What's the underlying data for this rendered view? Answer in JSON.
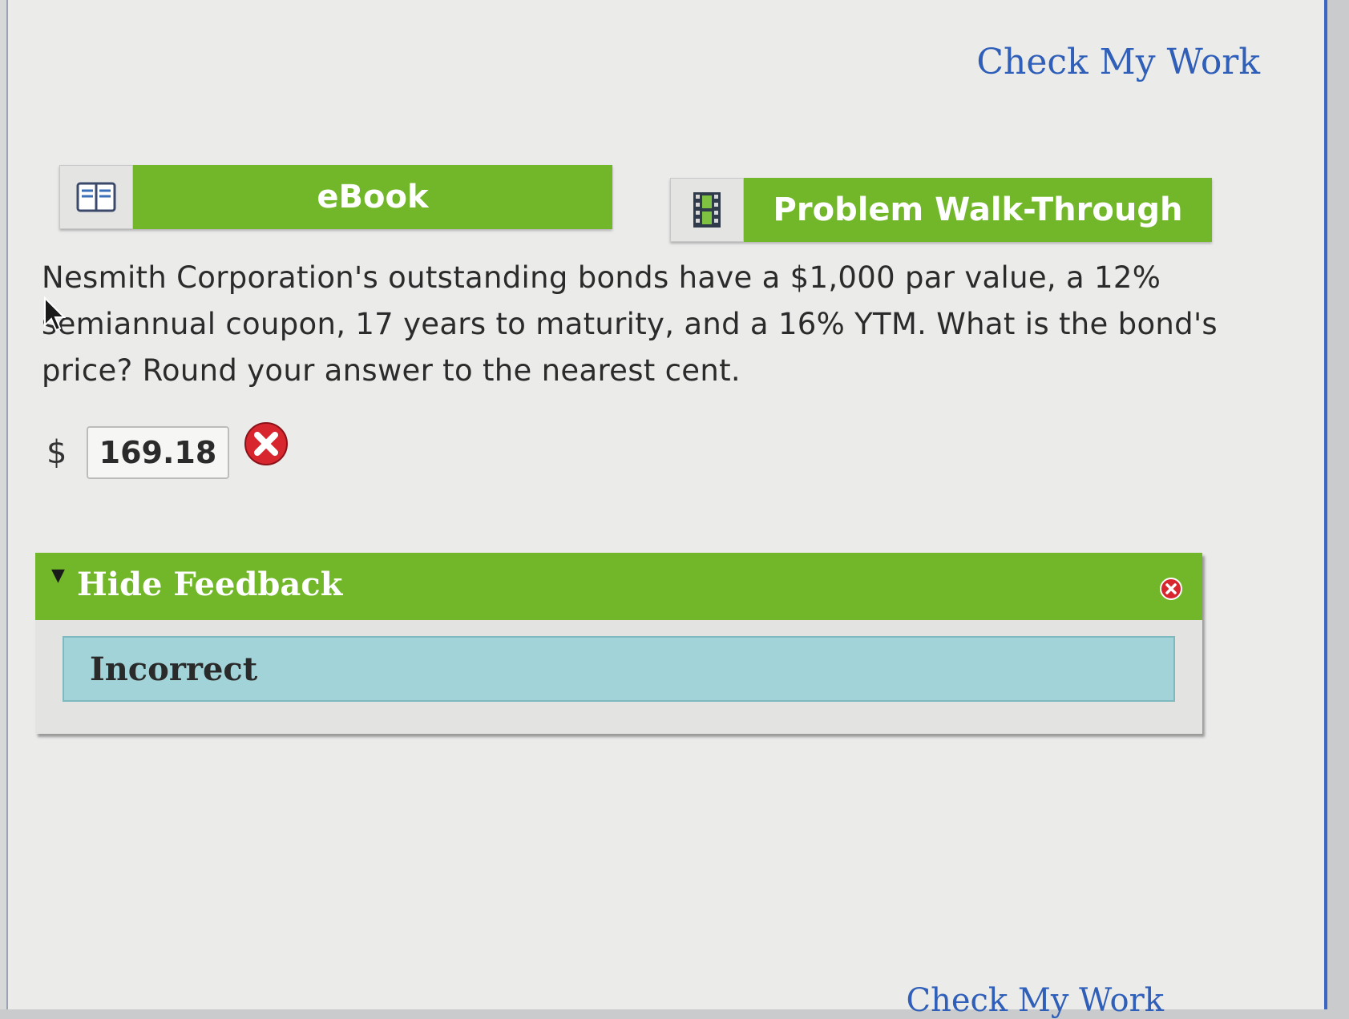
{
  "header": {
    "check_my_work_label": "Check My Work"
  },
  "tools": {
    "ebook_label": "eBook",
    "walkthrough_label": "Problem Walk-Through"
  },
  "question": {
    "text": "Nesmith Corporation's outstanding bonds have a $1,000 par value, a 12% semiannual coupon, 17 years to maturity, and a 16% YTM. What is the bond's price? Round your answer to the nearest cent."
  },
  "answer": {
    "currency_symbol": "$",
    "value": "169.18",
    "status": "incorrect"
  },
  "feedback": {
    "toggle_label": "Hide Feedback",
    "result_label": "Incorrect"
  },
  "footer": {
    "check_my_work_label": "Check My Work"
  },
  "colors": {
    "accent_green": "#72b72a",
    "link_blue": "#2f5fb8",
    "feedback_blue": "#a2d3d8",
    "error_red": "#d8262f"
  }
}
